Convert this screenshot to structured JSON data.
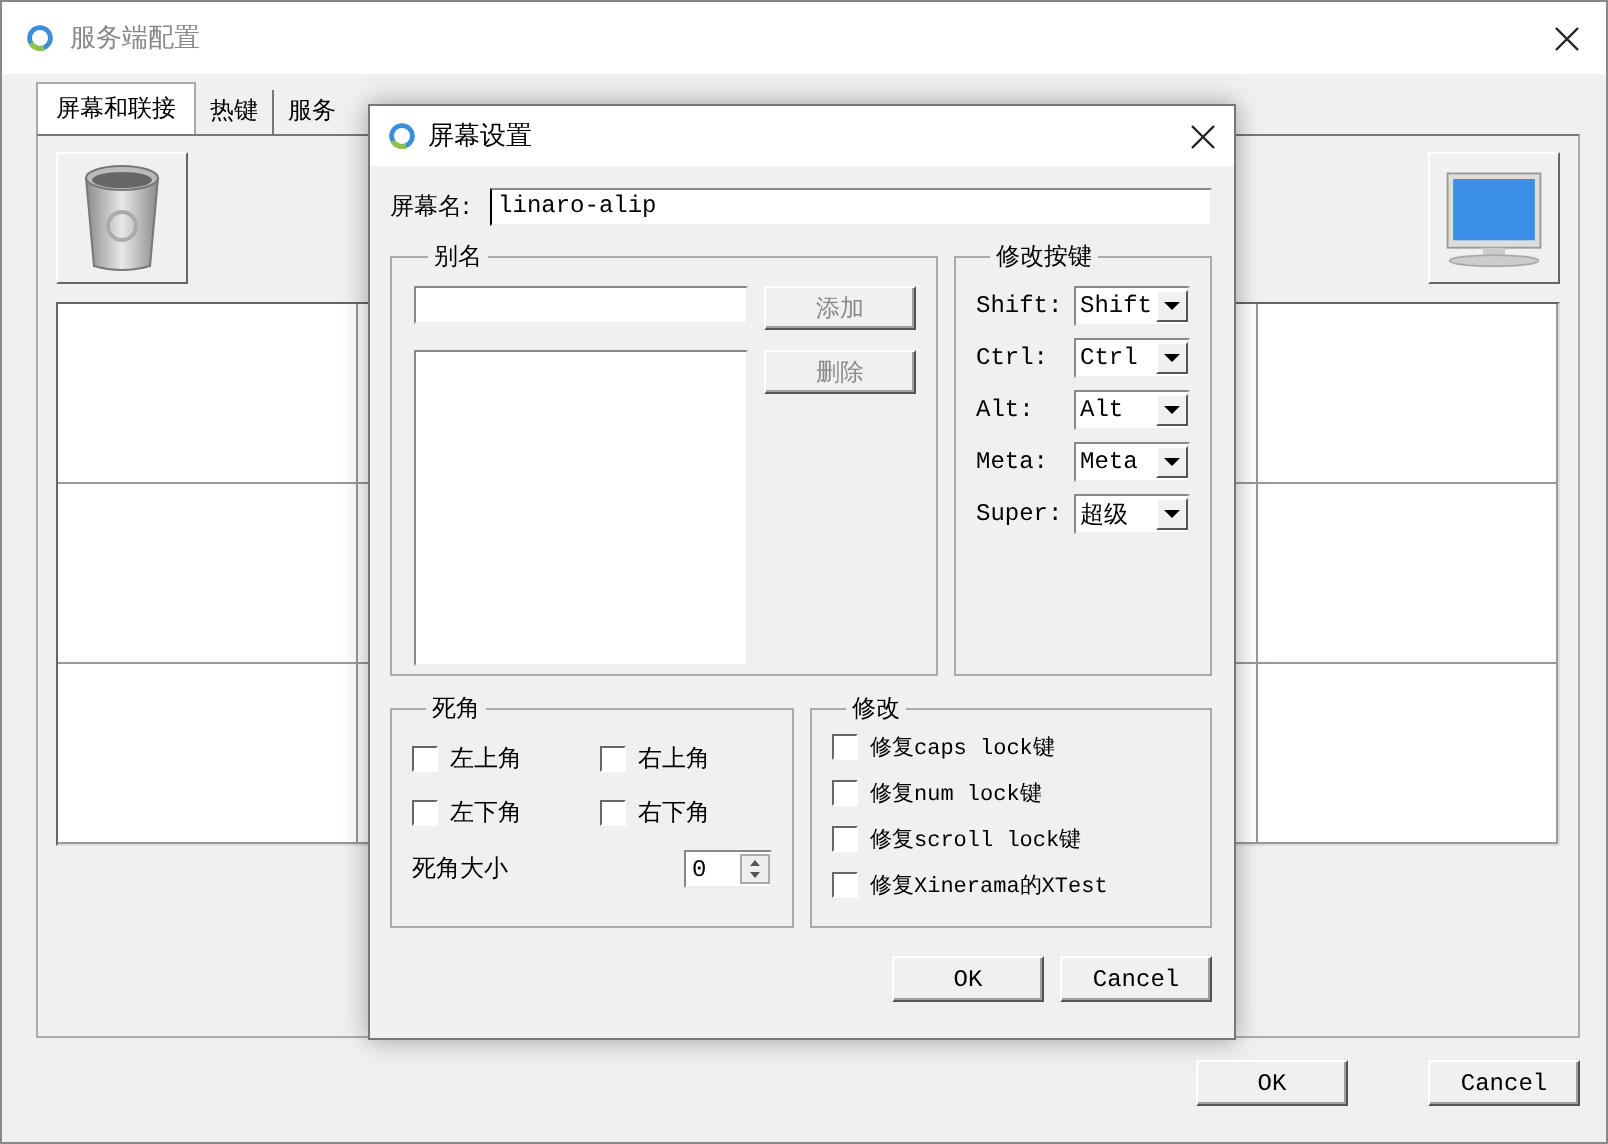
{
  "window": {
    "title": "服务端配置"
  },
  "tabs": [
    {
      "label": "屏幕和联接",
      "selected": true
    },
    {
      "label": "热键",
      "selected": false
    },
    {
      "label": "服务",
      "selected": false
    }
  ],
  "buttons": [
    "OK",
    "Cancel"
  ],
  "dialog": {
    "title": "屏幕设置",
    "screen_name": {
      "label": "屏幕名:",
      "value": "linaro-alip"
    },
    "aliases": {
      "title": "别名",
      "buttons": [
        {
          "label": "添加",
          "disabled": true
        },
        {
          "label": "删除",
          "disabled": true
        }
      ]
    },
    "modifier_keys": {
      "title": "修改按键",
      "rows": [
        {
          "label": "Shift:",
          "value": "Shift"
        },
        {
          "label": "Ctrl:",
          "value": "Ctrl"
        },
        {
          "label": "Alt:",
          "value": "Alt"
        },
        {
          "label": "Meta:",
          "value": "Meta"
        },
        {
          "label": "Super:",
          "value": "超级"
        }
      ]
    },
    "dead_corners": {
      "title": "死角",
      "corners": [
        {
          "label": "左上角",
          "checked": false
        },
        {
          "label": "右上角",
          "checked": false
        },
        {
          "label": "左下角",
          "checked": false
        },
        {
          "label": "右下角",
          "checked": false
        }
      ],
      "size": {
        "label": "死角大小",
        "value": "0"
      }
    },
    "fixes": {
      "title": "修改",
      "options": [
        {
          "label": "修复caps lock键",
          "checked": false
        },
        {
          "label": "修复num lock键",
          "checked": false
        },
        {
          "label": "修复scroll lock键",
          "checked": false
        },
        {
          "label": "修复Xinerama的XTest",
          "checked": false
        }
      ]
    },
    "buttons": [
      "OK",
      "Cancel"
    ]
  }
}
